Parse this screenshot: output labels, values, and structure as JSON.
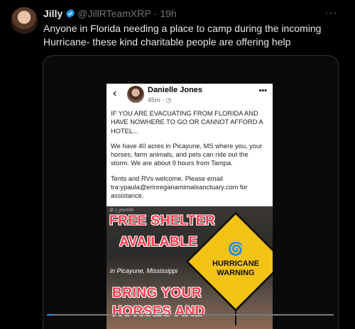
{
  "tweet": {
    "display_name": "Jilly",
    "handle": "@JillRTeamXRP",
    "separator": "·",
    "time": "19h",
    "text": "Anyone in Florida needing a place to camp during the incoming Hurricane- these kind charitable people are offering help",
    "more_label": "···"
  },
  "embedded_post": {
    "back_glyph": "‹",
    "author": "Danielle Jones",
    "meta": "45m · ◷",
    "more_label": "•••",
    "paragraphs": [
      "IF YOU ARE EVACUATING FROM FLORIDA AND HAVE NOWHERE TO GO OR CANNOT AFFORD A HOTEL...",
      "We have 40 acres in Picayune, MS where you, your horses, farm animals, and pets can ride out the storm. We are about 9 hours from Tampa.",
      "Tents and RVs welcome. Please email tra:ypaula@erinreganamimalsanctuary.com for assistance."
    ]
  },
  "banner": {
    "credit": "@ s_prem00",
    "line1": "FREE SHELTER",
    "line2": "AVAILABLE",
    "location": "in Picayune, Mississippi",
    "warning_line1": "HURRICANE",
    "warning_line2": "WARNING",
    "line3": "BRING YOUR",
    "line4": "HORSES AND"
  },
  "video": {
    "progress": 0.02
  },
  "colors": {
    "accent": "#1d9bf0",
    "banner_red": "#ff3b4d",
    "sign_yellow": "#f3c316"
  }
}
